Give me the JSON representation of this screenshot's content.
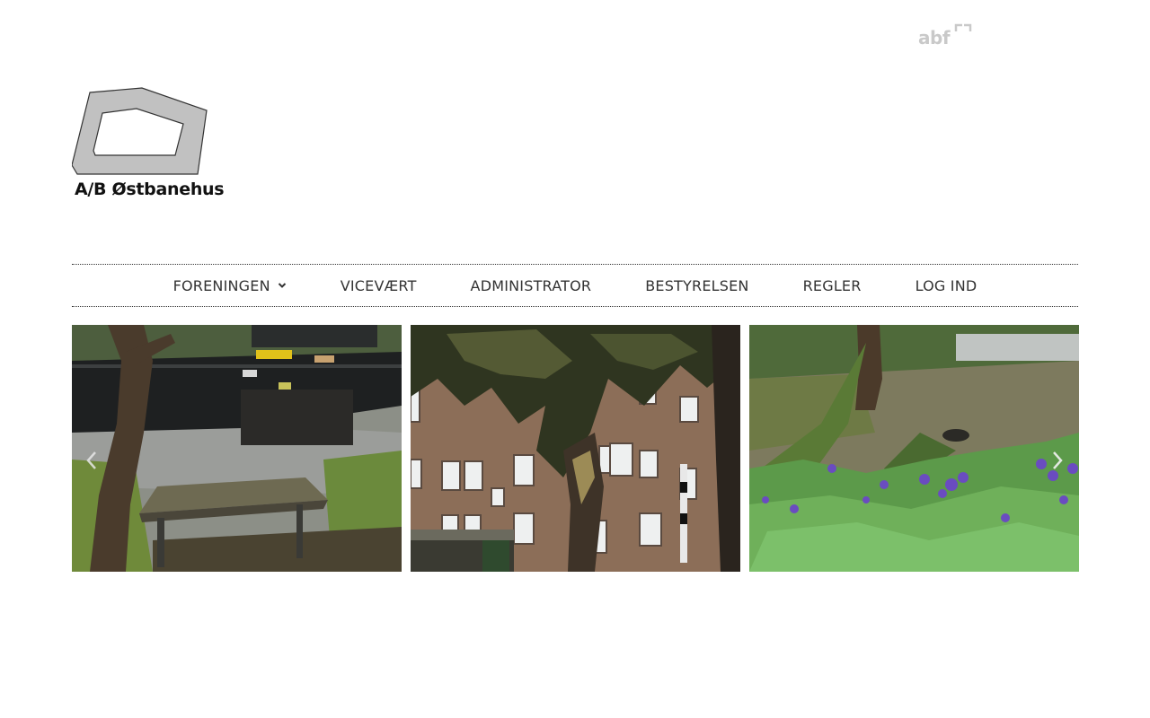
{
  "header": {
    "partner_logo": {
      "text": "abf",
      "icon": "abf-corner-icon",
      "color": "#c9c9c9"
    },
    "site_logo": {
      "text": "A/B Østbanehus",
      "fill": "#c1c1c1",
      "stroke": "#333333"
    }
  },
  "nav": {
    "items": [
      {
        "label": "FORENINGEN",
        "has_dropdown": true
      },
      {
        "label": "VICEVÆRT"
      },
      {
        "label": "ADMINISTRATOR"
      },
      {
        "label": "BESTYRELSEN"
      },
      {
        "label": "REGLER"
      },
      {
        "label": "LOG IND"
      }
    ]
  },
  "gallery": {
    "slides": [
      {
        "name": "courtyard-playground-photo"
      },
      {
        "name": "building-facade-tree-photo"
      },
      {
        "name": "garden-flowers-photo"
      }
    ],
    "prev_icon": "chevron-left-icon",
    "next_icon": "chevron-right-icon"
  }
}
